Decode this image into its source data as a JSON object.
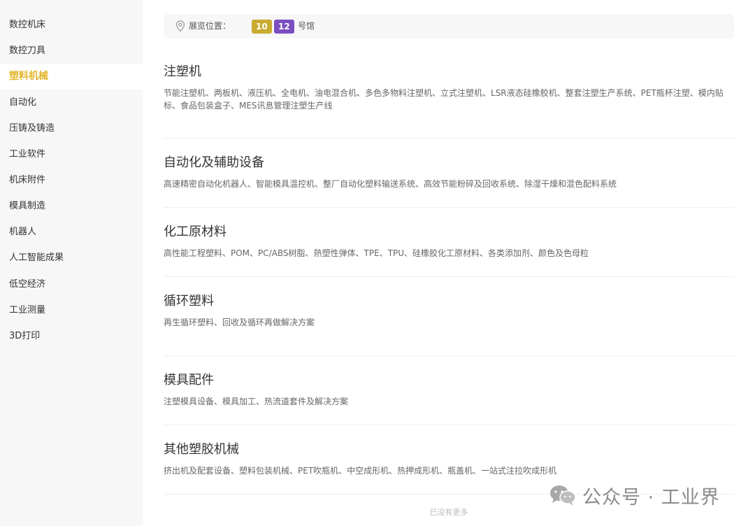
{
  "sidebar": {
    "items": [
      {
        "label": "数控机床",
        "active": false
      },
      {
        "label": "数控刀具",
        "active": false
      },
      {
        "label": "塑料机械",
        "active": true
      },
      {
        "label": "自动化",
        "active": false
      },
      {
        "label": "压铸及铸造",
        "active": false
      },
      {
        "label": "工业软件",
        "active": false
      },
      {
        "label": "机床附件",
        "active": false
      },
      {
        "label": "模具制造",
        "active": false
      },
      {
        "label": "机器人",
        "active": false
      },
      {
        "label": "人工智能成果",
        "active": false
      },
      {
        "label": "低空经济",
        "active": false
      },
      {
        "label": "工业测量",
        "active": false
      },
      {
        "label": "3D打印",
        "active": false
      }
    ],
    "active_color": "#e4b52a"
  },
  "location": {
    "label": "展览位置：",
    "halls": [
      {
        "number": "10",
        "color": "#c9ab2f"
      },
      {
        "number": "12",
        "color": "#7b4fc2"
      }
    ],
    "suffix": "号馆",
    "icon": "location-pin-icon"
  },
  "sections": [
    {
      "title": "注塑机",
      "items": "节能注塑机、两板机、液压机、全电机、油电混合机、多色多物料注塑机、立式注塑机、LSR液态硅橡胶机、整套注塑生产系统、PET瓶杯注塑、模内贴标、食品包装盒子、MES讯息管理注塑生产线"
    },
    {
      "title": "自动化及辅助设备",
      "items": "高速精密自动化机器人、智能模具温控机、整厂自动化塑料输送系统、高效节能粉碎及回收系统、除湿干燥和混色配料系统"
    },
    {
      "title": "化工原材料",
      "items": "高性能工程塑料、POM、PC/ABS树脂、熱塑性弹体、TPE、TPU、硅橡胶化工原材料、各类添加剂、颜色及色母粒"
    },
    {
      "title": "循环塑料",
      "items": "再生循环塑料、回收及循环再做解决方案"
    },
    {
      "title": "模具配件",
      "items": "注塑模具设备、模具加工、热流道套件及解决方案"
    },
    {
      "title": "其他塑胶机械",
      "items": "挤出机及配套设备、塑料包装机械、PET吹瓶机、中空成形机、热押成形机、瓶盖机、一站式注拉吹成形机"
    }
  ],
  "footer": {
    "text": "已没有更多"
  },
  "watermark": {
    "text": "公众号 · 工业界",
    "icon": "wechat-icon"
  }
}
